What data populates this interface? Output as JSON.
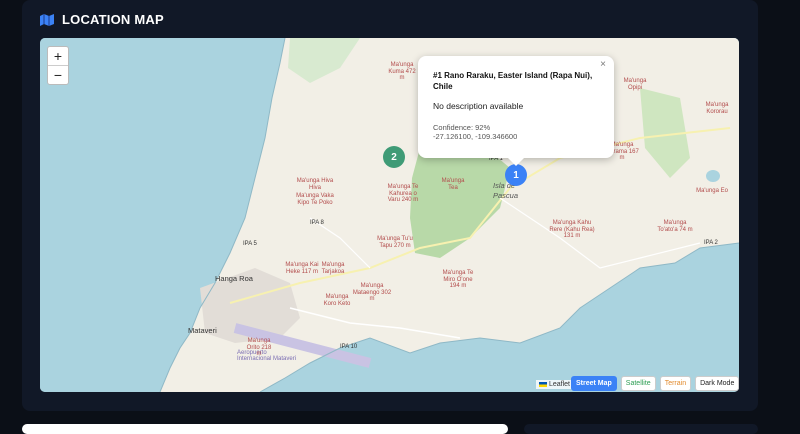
{
  "section": {
    "title": "LOCATION MAP"
  },
  "zoom": {
    "in": "+",
    "out": "−"
  },
  "popup": {
    "title": "#1 Rano Raraku, Easter Island (Rapa Nui), Chile",
    "description": "No description available",
    "confidence": "Confidence: 92%",
    "coordinates": "-27.126100, -109.346600",
    "close": "×"
  },
  "clusters": [
    {
      "label": "2",
      "color": "#3f9b76"
    },
    {
      "label": "1",
      "color": "#3b82f6"
    }
  ],
  "layers": {
    "street": "Street Map",
    "satellite": "Satellite",
    "terrain": "Terrain",
    "dark": "Dark Mode"
  },
  "attribution": "Leaflet",
  "map_labels": {
    "hanga_roa": "Hanga Roa",
    "mataveri": "Mataveri",
    "isla": "Isla de",
    "pascua": "Pascua",
    "ipa1": "IPA 1",
    "ipa2": "IPA 2",
    "ipa5": "IPA 5",
    "ipa8": "IPA 8",
    "ipa10": "IPA 10",
    "parque": "Parque Nacional Rapa Nui",
    "airport": "Aeropuerto Internacional Mataveri",
    "peaks": [
      "Ma'unga Kuma 472 m",
      "Ma'unga Hiva Hiva",
      "Ma'unga Vaka Kipo Te Poko",
      "Ma'unga Te Kahurea o Varu 240 m",
      "Ma'unga Tea",
      "Ma'unga Tu'u Tapu 270 m",
      "Ma'unga Kai Heke 117 m",
      "Ma'unga Tarjakoa",
      "Ma'unga Mataengo 302 m",
      "Ma'unga Te Miro O'one 194 m",
      "Ma'unga Kahu Rere (Kahu Rea) 131 m",
      "Ma'unga Orito 218 m",
      "Ma'unga Koro Keto",
      "Ma'unga Opipi",
      "Ma'unga Kororau",
      "Ma'unga Marama 167 m",
      "Ma'unga Eo",
      "Ma'unga To'ato'a 74 m"
    ]
  }
}
